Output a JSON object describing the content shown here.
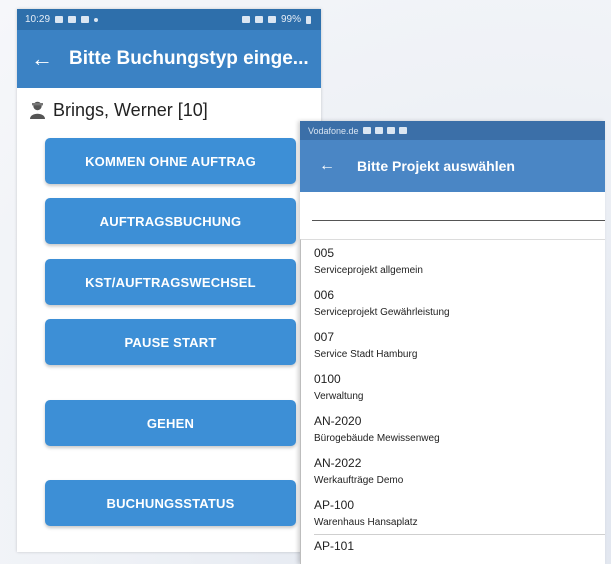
{
  "screen1": {
    "status": {
      "time": "10:29",
      "battery": "99%"
    },
    "back_icon": "arrow-left-icon",
    "title": "Bitte Buchungstyp einge...",
    "user": {
      "icon": "person-icon",
      "name": "Brings, Werner [10]"
    },
    "buttons": [
      "KOMMEN OHNE AUFTRAG",
      "AUFTRAGSBUCHUNG",
      "KST/AUFTRAGSWECHSEL",
      "PAUSE START",
      "GEHEN",
      "BUCHUNGSSTATUS"
    ]
  },
  "screen2": {
    "status": {
      "carrier": "Vodafone.de"
    },
    "back_icon": "arrow-left-icon",
    "title": "Bitte Projekt auswählen",
    "search": {
      "value": ""
    },
    "projects": [
      {
        "code": "005",
        "name": "Serviceprojekt allgemein"
      },
      {
        "code": "006",
        "name": "Serviceprojekt Gewährleistung"
      },
      {
        "code": "007",
        "name": "Service Stadt Hamburg"
      },
      {
        "code": "0100",
        "name": "Verwaltung"
      },
      {
        "code": "AN-2020",
        "name": "Bürogebäude Mewissenweg"
      },
      {
        "code": "AN-2022",
        "name": "Werkaufträge Demo"
      },
      {
        "code": "AP-100",
        "name": "Warenhaus Hansaplatz"
      },
      {
        "code": "AP-101",
        "name": ""
      }
    ]
  },
  "colors": {
    "statusbar": "#2e6fab",
    "appbar": "#3b82c4",
    "button": "#3d8fd6"
  }
}
